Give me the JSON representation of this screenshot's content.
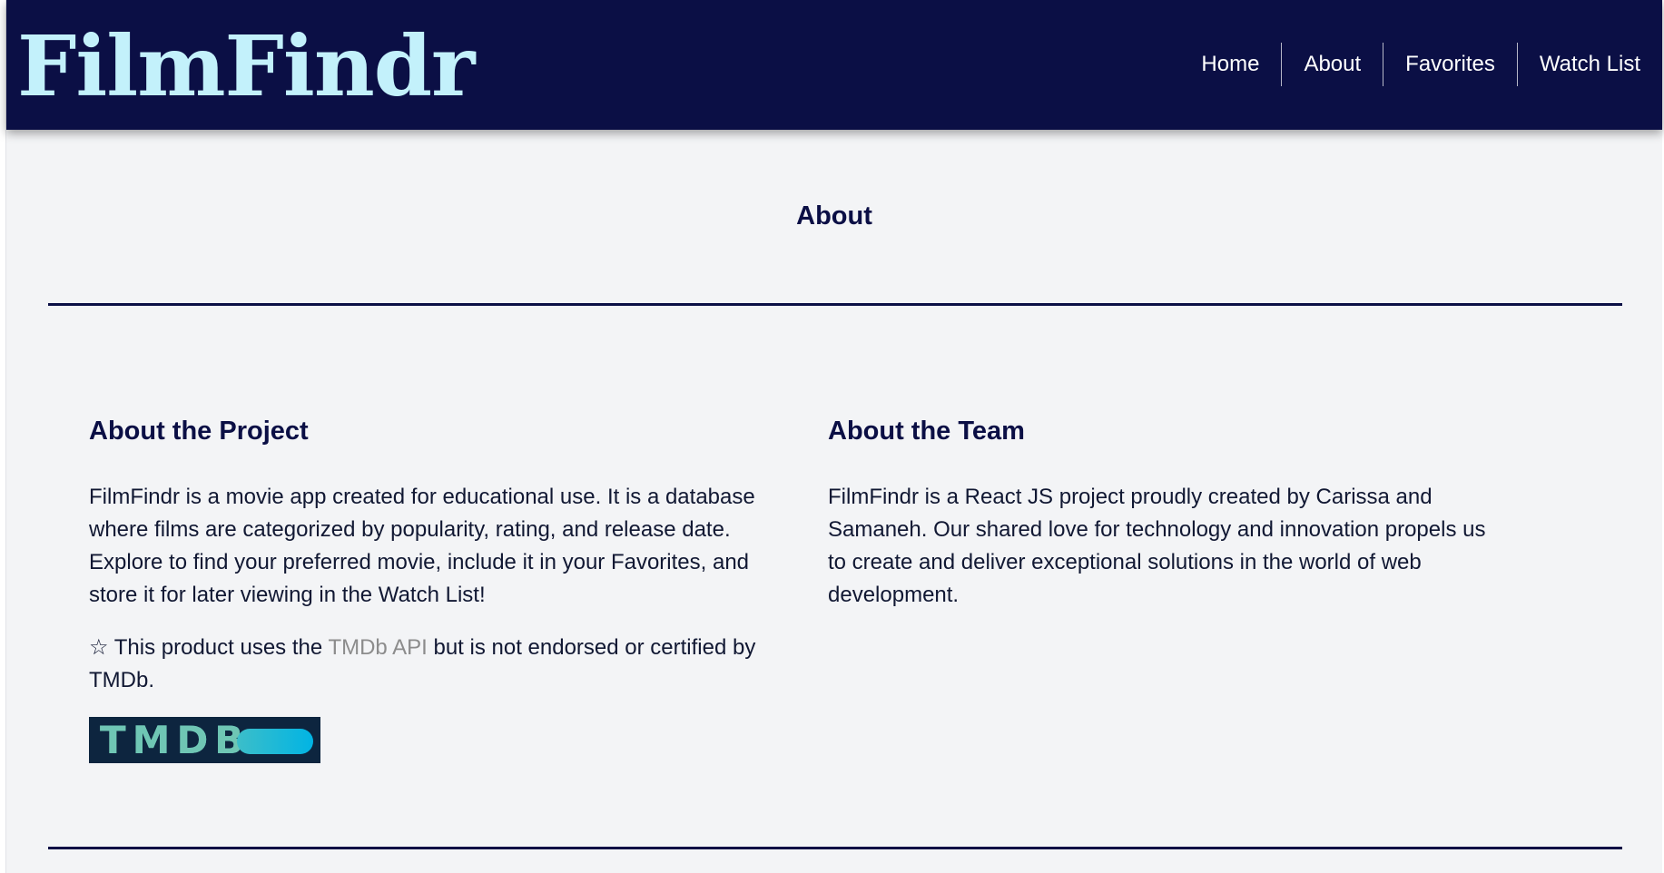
{
  "header": {
    "logo": "FilmFindr",
    "nav": [
      {
        "label": "Home"
      },
      {
        "label": "About"
      },
      {
        "label": "Favorites"
      },
      {
        "label": "Watch List"
      }
    ]
  },
  "main": {
    "title": "About",
    "project": {
      "heading": "About the Project",
      "paragraph": "FilmFindr is a movie app created for educational use. It is a database where films are categorized by popularity, rating, and release date. Explore to find your preferred movie, include it in your Favorites, and store it for later viewing in the Watch List!",
      "attribution_prefix": "☆ This product uses the ",
      "attribution_link": "TMDb API",
      "attribution_suffix": " but is not endorsed or certified by TMDb.",
      "logo_text": "TMDB"
    },
    "team": {
      "heading": "About the Team",
      "paragraph": "FilmFindr is a React JS project proudly created by Carissa and Samaneh. Our shared love for technology and innovation propels us to create and deliver exceptional solutions in the world of web development."
    }
  },
  "colors": {
    "header_bg": "#0b0f45",
    "logo": "#c3f1fb",
    "page_bg": "#f3f4f6",
    "text": "#111833",
    "link": "#8c8c8c",
    "tmdb_bg": "#0d253f"
  }
}
